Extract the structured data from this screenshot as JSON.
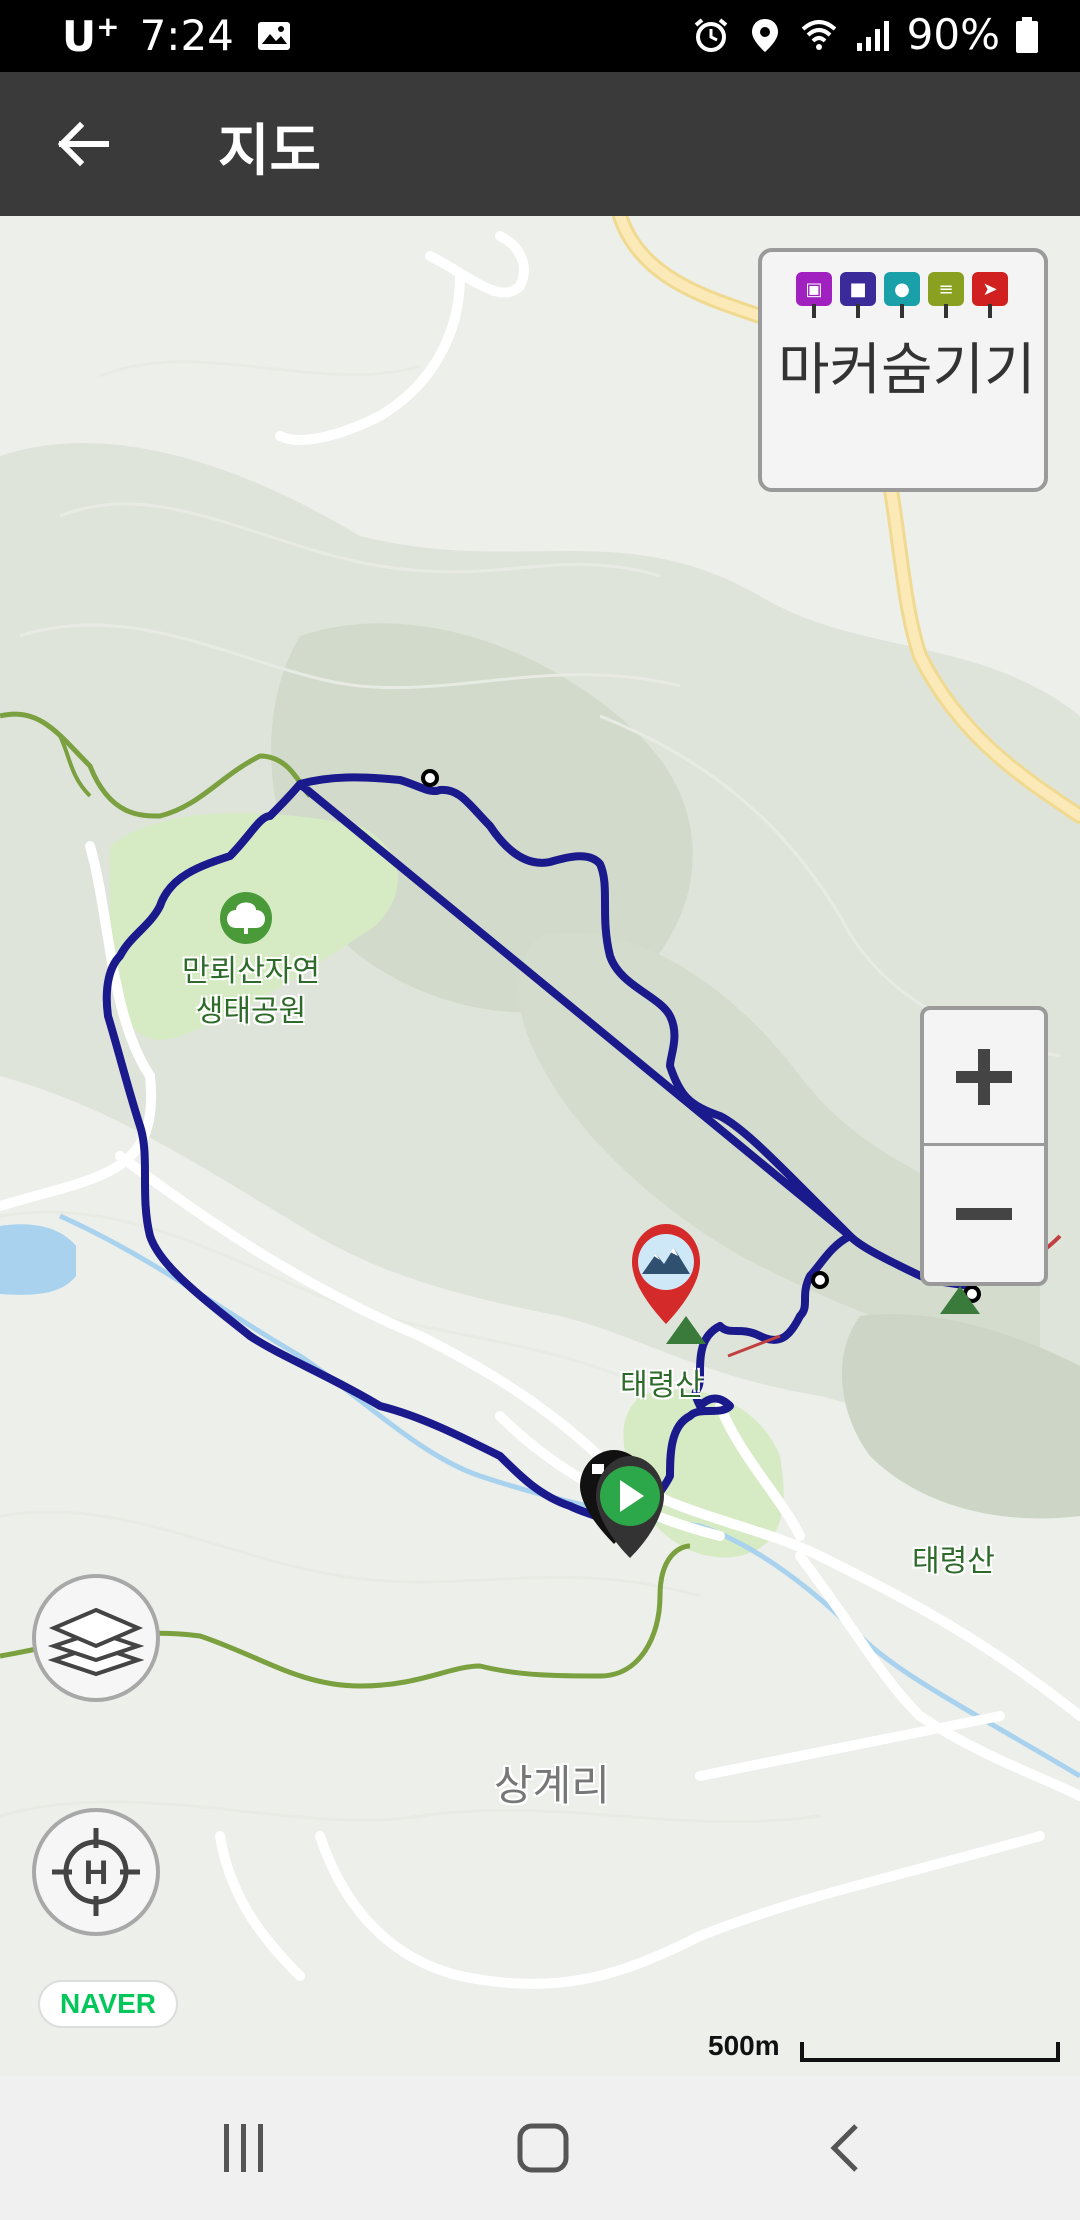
{
  "status_bar": {
    "carrier": "U",
    "carrier_sup": "+",
    "time": "7:24",
    "battery": "90%",
    "icons": [
      "image-icon",
      "alarm-icon",
      "location-icon",
      "wifi-icon",
      "signal-icon",
      "battery-icon"
    ]
  },
  "app_bar": {
    "title": "지도",
    "back_icon": "arrow-left-icon"
  },
  "marker_panel": {
    "label": "마커숨기기",
    "pins": [
      {
        "name": "photo-marker-icon",
        "color": "#a020c0",
        "glyph": "📷"
      },
      {
        "name": "video-marker-icon",
        "color": "#3a2a9a",
        "glyph": "■"
      },
      {
        "name": "audio-marker-icon",
        "color": "#1aa0a8",
        "glyph": "●"
      },
      {
        "name": "memo-marker-icon",
        "color": "#8aa020",
        "glyph": "≡"
      },
      {
        "name": "point-marker-icon",
        "color": "#d02020",
        "glyph": "➤"
      }
    ]
  },
  "map": {
    "labels": {
      "park": "만뢰산자연\n생태공원",
      "peak1": "태령산",
      "peak2": "태령산",
      "village": "상계리"
    },
    "route_color": "#1a1a8c",
    "trail_color": "#7aa040",
    "road_color": "#f6e2a0",
    "scale_label": "500m",
    "attribution": "NAVER"
  },
  "controls": {
    "zoom_in_icon": "plus-icon",
    "zoom_out_icon": "minus-icon",
    "layers_icon": "layers-icon",
    "locate_icon": "crosshair-h-icon"
  },
  "nav_bar": {
    "icons": [
      "recent-apps-icon",
      "home-icon",
      "back-icon"
    ]
  }
}
